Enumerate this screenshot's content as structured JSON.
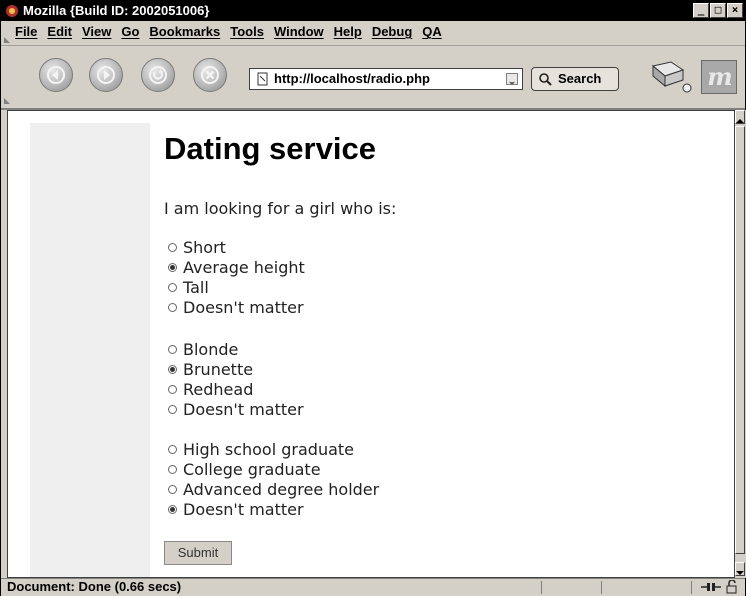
{
  "window": {
    "title": "Mozilla {Build ID: 2002051006}",
    "controls": {
      "minimize": "_",
      "maximize": "□",
      "close": "×"
    }
  },
  "menubar": {
    "items": [
      "File",
      "Edit",
      "View",
      "Go",
      "Bookmarks",
      "Tools",
      "Window",
      "Help",
      "Debug",
      "QA"
    ]
  },
  "navbar": {
    "url": "http://localhost/radio.php",
    "search_label": "Search",
    "icons": [
      "back-icon",
      "forward-icon",
      "reload-icon",
      "stop-icon",
      "page-icon",
      "search-icon",
      "printer-icon",
      "throbber-logo"
    ]
  },
  "page": {
    "heading": "Dating service",
    "intro": "I am looking for a girl who is:",
    "groups": [
      {
        "options": [
          {
            "label": "Short",
            "checked": false
          },
          {
            "label": "Average height",
            "checked": true
          },
          {
            "label": "Tall",
            "checked": false
          },
          {
            "label": "Doesn't matter",
            "checked": false
          }
        ]
      },
      {
        "options": [
          {
            "label": "Blonde",
            "checked": false
          },
          {
            "label": "Brunette",
            "checked": true
          },
          {
            "label": "Redhead",
            "checked": false
          },
          {
            "label": "Doesn't matter",
            "checked": false
          }
        ]
      },
      {
        "options": [
          {
            "label": "High school graduate",
            "checked": false
          },
          {
            "label": "College graduate",
            "checked": false
          },
          {
            "label": "Advanced degree holder",
            "checked": false
          },
          {
            "label": "Doesn't matter",
            "checked": true
          }
        ]
      }
    ],
    "submit_label": "Submit"
  },
  "statusbar": {
    "text": "Document: Done (0.66 secs)"
  },
  "colors": {
    "titlebar_bg": "#000000",
    "chrome_bg": "#d4d0c8",
    "content_bg": "#ffffff",
    "sidebar_bg": "#efefef"
  }
}
